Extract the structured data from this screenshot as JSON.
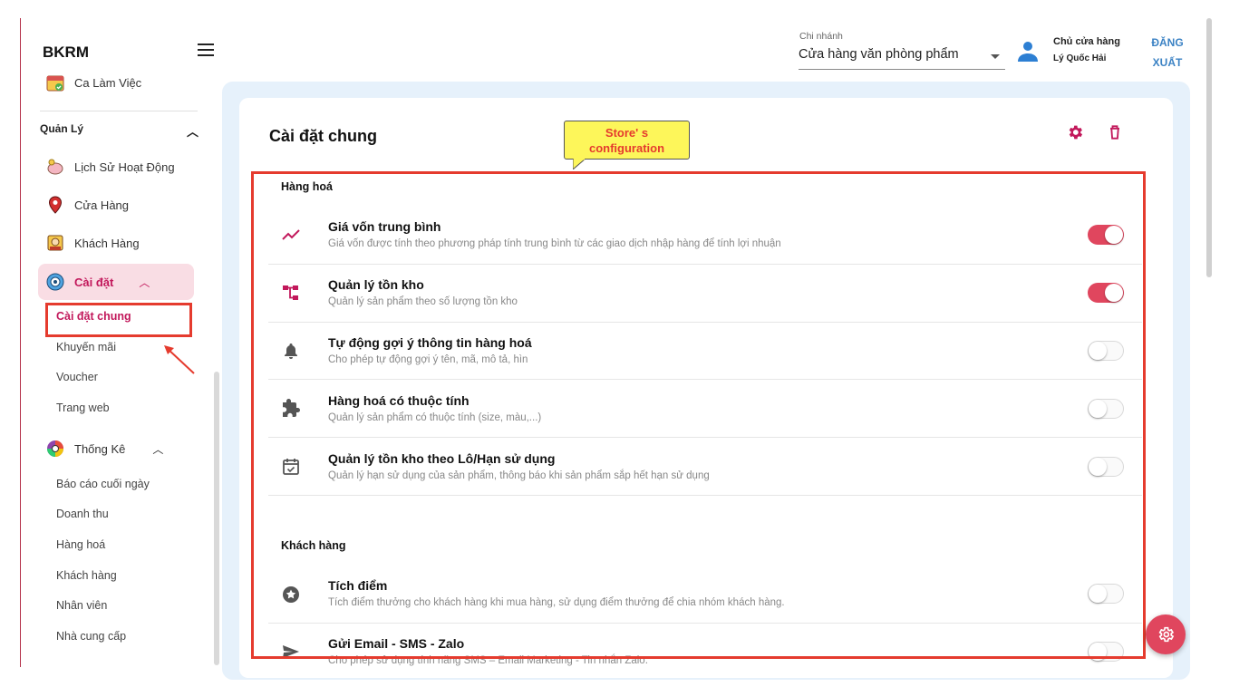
{
  "sidebar": {
    "brand": "BKRM",
    "top_item": "Ca Làm Việc",
    "section_title": "Quản Lý",
    "items": [
      {
        "label": "Lịch Sử Hoạt Động",
        "icon": "piggy-bank-icon"
      },
      {
        "label": "Cửa Hàng",
        "icon": "map-pin-icon"
      },
      {
        "label": "Khách Hàng",
        "icon": "customer-icon"
      }
    ],
    "settings_label": "Cài đặt",
    "settings_sub": [
      "Cài đặt chung",
      "Khuyến mãi",
      "Voucher",
      "Trang web"
    ],
    "stats_label": "Thống Kê",
    "stats_sub": [
      "Báo cáo cuối ngày",
      "Doanh thu",
      "Hàng hoá",
      "Khách hàng",
      "Nhân viên",
      "Nhà cung cấp"
    ]
  },
  "header": {
    "branch_label": "Chi nhánh",
    "branch_value": "Cửa hàng văn phòng phẩm",
    "user_role": "Chủ cửa hàng",
    "user_name": "Lý Quốc Hải",
    "logout_line1": "ĐĂNG",
    "logout_line2": "XUẤT"
  },
  "main": {
    "title": "Cài đặt chung",
    "callout_line1": "Store' s",
    "callout_line2": "configuration",
    "groups": [
      {
        "title": "Hàng hoá",
        "rows": [
          {
            "title": "Giá vốn trung bình",
            "desc": "Giá vốn được tính theo phương pháp tính trung bình từ các giao dịch nhập hàng để tính lợi nhuận",
            "enabled": true,
            "icon": "trending-up-icon"
          },
          {
            "title": "Quản lý tồn kho",
            "desc": "Quản lý sản phẩm theo số lượng tồn kho",
            "enabled": true,
            "icon": "inventory-tree-icon"
          },
          {
            "title": "Tự động gợi ý thông tin hàng hoá",
            "desc": "Cho phép tự động gợi ý tên, mã, mô tả, hìn",
            "enabled": false,
            "icon": "bell-icon"
          },
          {
            "title": "Hàng hoá có thuộc tính",
            "desc": "Quản lý sản phẩm có thuộc tính (size, màu,...)",
            "enabled": false,
            "icon": "puzzle-icon"
          },
          {
            "title": "Quản lý tồn kho theo Lô/Hạn sử dụng",
            "desc": "Quản lý hạn sử dụng của sản phẩm, thông báo khi sản phẩm sắp hết hạn sử dụng",
            "enabled": false,
            "icon": "calendar-check-icon"
          }
        ]
      },
      {
        "title": "Khách hàng",
        "rows": [
          {
            "title": "Tích điểm",
            "desc": "Tích điểm thưởng cho khách hàng khi mua hàng, sử dụng điểm thưởng để chia nhóm khách hàng.",
            "enabled": false,
            "icon": "star-circle-icon"
          },
          {
            "title": "Gửi Email - SMS - Zalo",
            "desc": "Cho phép sử dụng tính năng SMS – Email Marketing - Tin nhắn Zalo.",
            "enabled": false,
            "icon": "send-icon"
          }
        ]
      }
    ]
  },
  "colors": {
    "accent": "#e0465e",
    "annotation": "#e53b2e",
    "link": "#3b82c4"
  }
}
